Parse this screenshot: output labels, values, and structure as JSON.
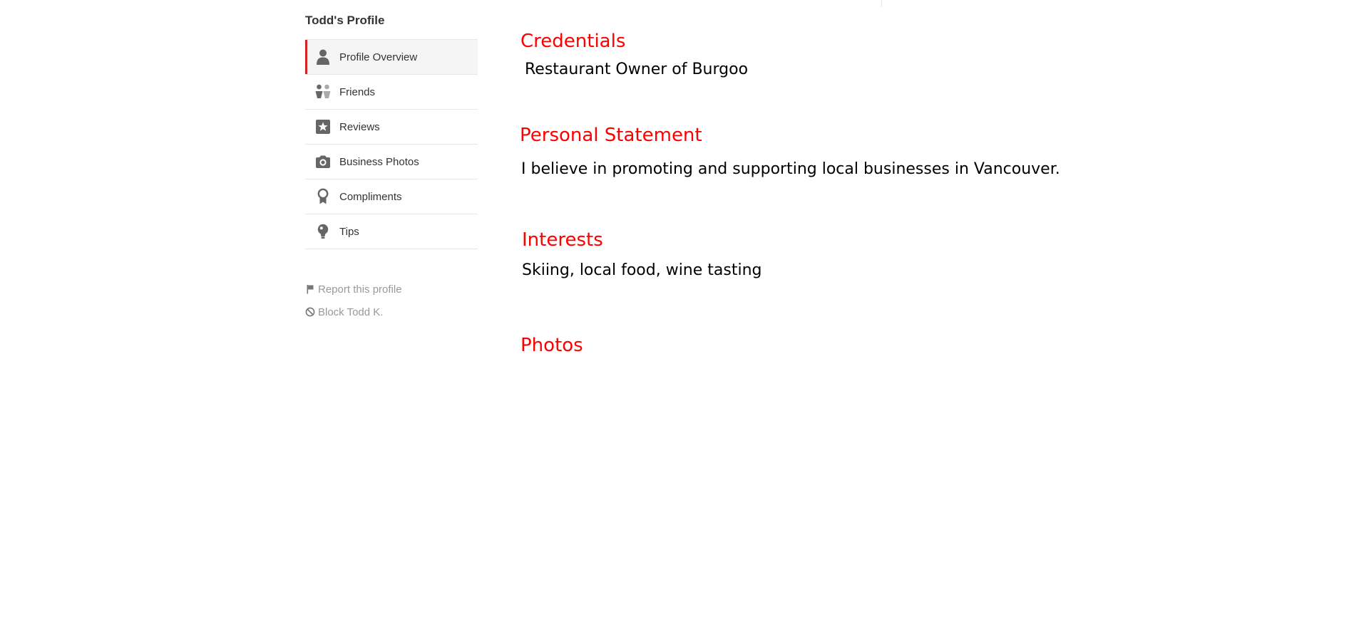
{
  "sidebar": {
    "title": "Todd's Profile",
    "items": [
      {
        "label": "Profile Overview",
        "icon": "person-icon",
        "active": true
      },
      {
        "label": "Friends",
        "icon": "friends-icon",
        "active": false
      },
      {
        "label": "Reviews",
        "icon": "star-icon",
        "active": false
      },
      {
        "label": "Business Photos",
        "icon": "camera-icon",
        "active": false
      },
      {
        "label": "Compliments",
        "icon": "award-icon",
        "active": false
      },
      {
        "label": "Tips",
        "icon": "lightbulb-icon",
        "active": false
      }
    ],
    "actions": [
      {
        "label": "Report this profile",
        "icon": "flag-icon"
      },
      {
        "label": "Block Todd K.",
        "icon": "block-icon"
      }
    ]
  },
  "main": {
    "credentials": {
      "heading": "Credentials",
      "text": "Restaurant Owner of Burgoo"
    },
    "personal_statement": {
      "heading": "Personal Statement",
      "text": "I believe in promoting and supporting local businesses in Vancouver."
    },
    "interests": {
      "heading": "Interests",
      "text": "Skiing, local food, wine tasting"
    },
    "photos": {
      "heading": "Photos"
    }
  },
  "colors": {
    "accent": "#d32323",
    "heading": "#ff0000",
    "muted": "#999999",
    "icon": "#666666"
  }
}
